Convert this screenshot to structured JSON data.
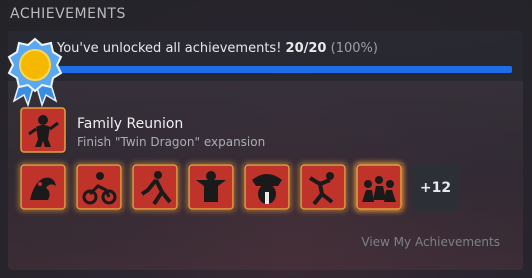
{
  "section": {
    "title": "ACHIEVEMENTS"
  },
  "progress": {
    "summary_text": "You've unlocked all achievements!",
    "count": "20/20",
    "percent_text": "(100%)",
    "fraction": 1.0,
    "bar_color": "#1f6ee8"
  },
  "recent": {
    "name": "Family Reunion",
    "description": "Finish \"Twin Dragon\" expansion",
    "icon": "ninja-figure-icon"
  },
  "achievement_icons": [
    "dragon-icon",
    "motorcycle-rider-icon",
    "fighter-icon",
    "ninja-pose-icon",
    "masked-villain-icon",
    "brawler-icon",
    "skull-boss-icon",
    "crowd-icon"
  ],
  "more": {
    "label": "+12"
  },
  "link": {
    "view_label": "View My Achievements"
  },
  "colors": {
    "icon_red": "#c0332b",
    "icon_border": "#e0a040",
    "badge_gold": "#f5b800",
    "badge_ribbon": "#3a8de0"
  }
}
